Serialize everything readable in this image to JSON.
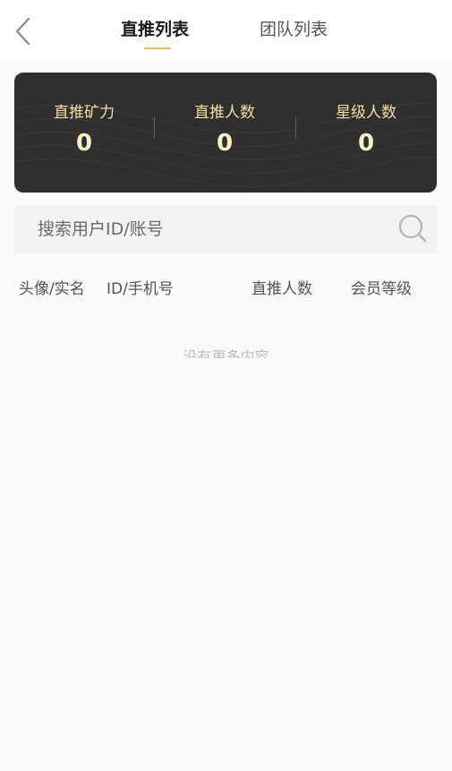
{
  "header": {
    "back_icon": "chevron-left-icon",
    "tabs": [
      {
        "label": "直推列表",
        "active": true
      },
      {
        "label": "团队列表",
        "active": false
      }
    ],
    "accent_color": "#e6c15a"
  },
  "stats": {
    "items": [
      {
        "label": "直推矿力",
        "value": "0"
      },
      {
        "label": "直推人数",
        "value": "0"
      },
      {
        "label": "星级人数",
        "value": "0"
      }
    ],
    "card_color": "#2f2f2f",
    "label_color": "#f1dfa2"
  },
  "search": {
    "placeholder": "搜索用户ID/账号",
    "icon": "search-icon"
  },
  "table": {
    "columns": [
      "头像/实名",
      "ID/手机号",
      "直推人数",
      "会员等级"
    ]
  },
  "empty_state": {
    "text": "没有更多内容"
  }
}
